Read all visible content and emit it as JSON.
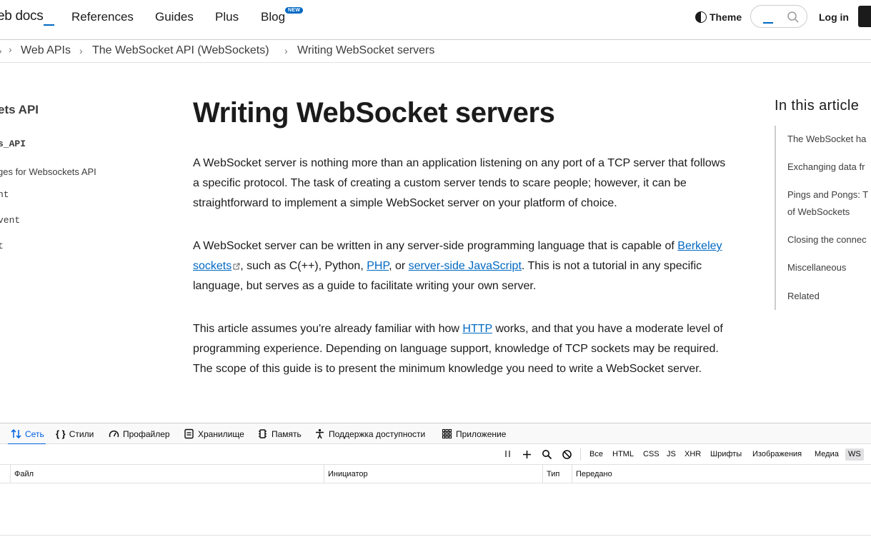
{
  "header": {
    "logo": "eb docs",
    "nav": [
      "References",
      "Guides",
      "Plus",
      "Blog"
    ],
    "new_badge": "NEW",
    "theme_label": "Theme",
    "login_label": "Log in"
  },
  "breadcrumb": {
    "items": [
      "Web APIs",
      "The WebSocket API (WebSockets)",
      "Writing WebSocket servers"
    ],
    "separator": "›"
  },
  "sidebar": {
    "title": "ets API",
    "items": [
      "s_API",
      "ges for Websockets API",
      "nt",
      "vent",
      "t"
    ]
  },
  "article": {
    "title": "Writing WebSocket servers",
    "p1": "A WebSocket server is nothing more than an application listening on any port of a TCP server that follows a specific protocol. The task of creating a custom server tends to scare people; however, it can be straightforward to implement a simple WebSocket server on your platform of choice.",
    "p2_a": "A WebSocket server can be written in any server-side programming language that is capable of ",
    "p2_link1": "Berkeley sockets",
    "p2_b": ", such as C(++), Python, ",
    "p2_link2": "PHP",
    "p2_c": ", or ",
    "p2_link3": "server-side JavaScript",
    "p2_d": ". This is not a tutorial in any specific language, but serves as a guide to facilitate writing your own server.",
    "p3_a": "This article assumes you're already familiar with how ",
    "p3_link": "HTTP",
    "p3_b": " works, and that you have a moderate level of programming experience. Depending on language support, knowledge of TCP sockets may be required. The scope of this guide is to present the minimum knowledge you need to write a WebSocket server."
  },
  "toc": {
    "title": "In this article",
    "items": [
      "The WebSocket ha",
      "Exchanging data fr",
      "Pings and Pongs: T of WebSockets",
      "Closing the connec",
      "Miscellaneous",
      "Related"
    ]
  },
  "devtools": {
    "tabs": [
      "Сеть",
      "Стили",
      "Профайлер",
      "Хранилище",
      "Память",
      "Поддержка доступности",
      "Приложение"
    ],
    "filters": [
      "Все",
      "HTML",
      "CSS",
      "JS",
      "XHR",
      "Шрифты",
      "Изображения",
      "Медиа",
      "WS"
    ],
    "columns": [
      "Файл",
      "Инициатор",
      "Тип",
      "Передано"
    ]
  },
  "colors": {
    "link": "#0069c2",
    "devtools_active": "#0060df"
  }
}
